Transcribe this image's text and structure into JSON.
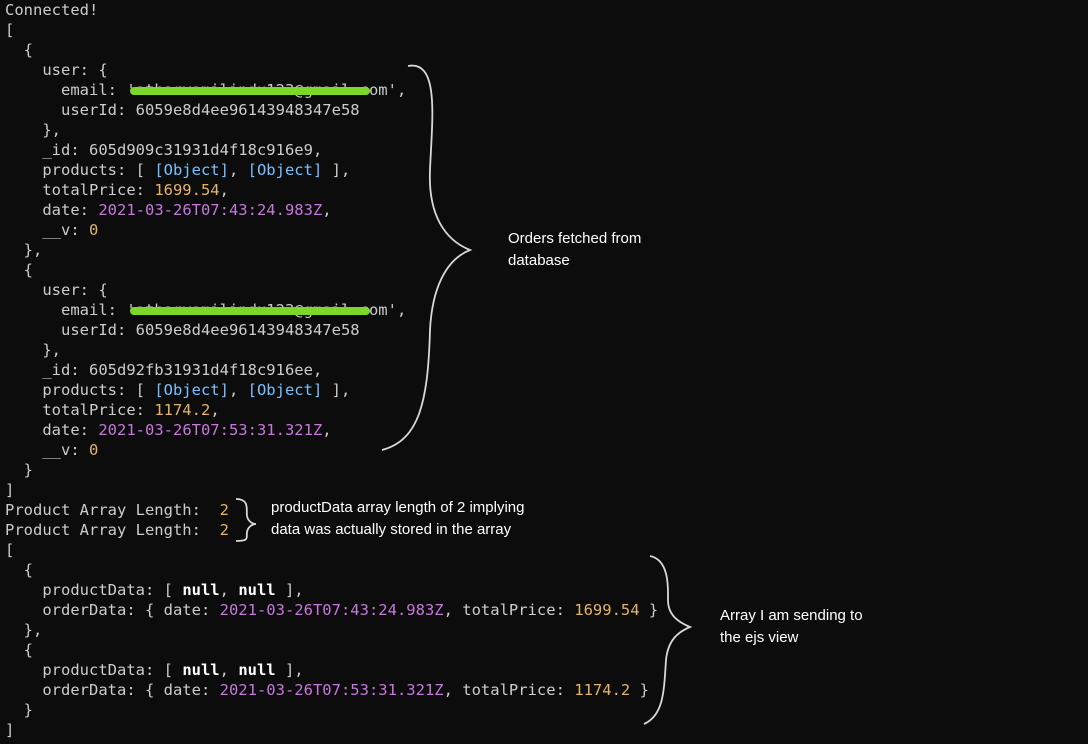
{
  "terminal": {
    "lines": [
      [
        {
          "t": "Connected!",
          "c": ""
        }
      ],
      [
        {
          "t": "[",
          "c": ""
        }
      ],
      [
        {
          "t": "  {",
          "c": ""
        }
      ],
      [
        {
          "t": "    user: {",
          "c": ""
        }
      ],
      [
        {
          "t": "      email: '",
          "c": ""
        },
        {
          "t": "atharvamilindu123@gmail.com",
          "c": "t-email"
        },
        {
          "t": "',",
          "c": ""
        }
      ],
      [
        {
          "t": "      userId: 6059e8d4ee96143948347e58",
          "c": ""
        }
      ],
      [
        {
          "t": "    },",
          "c": ""
        }
      ],
      [
        {
          "t": "    _id: 605d909c31931d4f18c916e9,",
          "c": ""
        }
      ],
      [
        {
          "t": "    products: [ ",
          "c": ""
        },
        {
          "t": "[Object]",
          "c": "t-cyan"
        },
        {
          "t": ", ",
          "c": ""
        },
        {
          "t": "[Object]",
          "c": "t-cyan"
        },
        {
          "t": " ],",
          "c": ""
        }
      ],
      [
        {
          "t": "    totalPrice: ",
          "c": ""
        },
        {
          "t": "1699.54",
          "c": "t-num"
        },
        {
          "t": ",",
          "c": ""
        }
      ],
      [
        {
          "t": "    date: ",
          "c": ""
        },
        {
          "t": "2021-03-26T07:43:24.983Z",
          "c": "t-date"
        },
        {
          "t": ",",
          "c": ""
        }
      ],
      [
        {
          "t": "    __v: ",
          "c": ""
        },
        {
          "t": "0",
          "c": "t-num"
        }
      ],
      [
        {
          "t": "  },",
          "c": ""
        }
      ],
      [
        {
          "t": "  {",
          "c": ""
        }
      ],
      [
        {
          "t": "    user: {",
          "c": ""
        }
      ],
      [
        {
          "t": "      email: '",
          "c": ""
        },
        {
          "t": "atharvamilindu123@gmail.com",
          "c": "t-email"
        },
        {
          "t": "',",
          "c": ""
        }
      ],
      [
        {
          "t": "      userId: 6059e8d4ee96143948347e58",
          "c": ""
        }
      ],
      [
        {
          "t": "    },",
          "c": ""
        }
      ],
      [
        {
          "t": "    _id: 605d92fb31931d4f18c916ee,",
          "c": ""
        }
      ],
      [
        {
          "t": "    products: [ ",
          "c": ""
        },
        {
          "t": "[Object]",
          "c": "t-cyan"
        },
        {
          "t": ", ",
          "c": ""
        },
        {
          "t": "[Object]",
          "c": "t-cyan"
        },
        {
          "t": " ],",
          "c": ""
        }
      ],
      [
        {
          "t": "    totalPrice: ",
          "c": ""
        },
        {
          "t": "1174.2",
          "c": "t-num"
        },
        {
          "t": ",",
          "c": ""
        }
      ],
      [
        {
          "t": "    date: ",
          "c": ""
        },
        {
          "t": "2021-03-26T07:53:31.321Z",
          "c": "t-date"
        },
        {
          "t": ",",
          "c": ""
        }
      ],
      [
        {
          "t": "    __v: ",
          "c": ""
        },
        {
          "t": "0",
          "c": "t-num"
        }
      ],
      [
        {
          "t": "  }",
          "c": ""
        }
      ],
      [
        {
          "t": "]",
          "c": ""
        }
      ],
      [
        {
          "t": "Product Array Length:  ",
          "c": ""
        },
        {
          "t": "2",
          "c": "t-num"
        }
      ],
      [
        {
          "t": "Product Array Length:  ",
          "c": ""
        },
        {
          "t": "2",
          "c": "t-num"
        }
      ],
      [
        {
          "t": "[",
          "c": ""
        }
      ],
      [
        {
          "t": "  {",
          "c": ""
        }
      ],
      [
        {
          "t": "    productData: [ ",
          "c": ""
        },
        {
          "t": "null",
          "c": "t-bold"
        },
        {
          "t": ", ",
          "c": ""
        },
        {
          "t": "null",
          "c": "t-bold"
        },
        {
          "t": " ],",
          "c": ""
        }
      ],
      [
        {
          "t": "    orderData: { date: ",
          "c": ""
        },
        {
          "t": "2021-03-26T07:43:24.983Z",
          "c": "t-date"
        },
        {
          "t": ", totalPrice: ",
          "c": ""
        },
        {
          "t": "1699.54",
          "c": "t-num"
        },
        {
          "t": " }",
          "c": ""
        }
      ],
      [
        {
          "t": "  },",
          "c": ""
        }
      ],
      [
        {
          "t": "  {",
          "c": ""
        }
      ],
      [
        {
          "t": "    productData: [ ",
          "c": ""
        },
        {
          "t": "null",
          "c": "t-bold"
        },
        {
          "t": ", ",
          "c": ""
        },
        {
          "t": "null",
          "c": "t-bold"
        },
        {
          "t": " ],",
          "c": ""
        }
      ],
      [
        {
          "t": "    orderData: { date: ",
          "c": ""
        },
        {
          "t": "2021-03-26T07:53:31.321Z",
          "c": "t-date"
        },
        {
          "t": ", totalPrice: ",
          "c": ""
        },
        {
          "t": "1174.2",
          "c": "t-num"
        },
        {
          "t": " }",
          "c": ""
        }
      ],
      [
        {
          "t": "  }",
          "c": ""
        }
      ],
      [
        {
          "t": "]",
          "c": ""
        }
      ]
    ]
  },
  "annotations": {
    "orders_note": [
      "Orders fetched from",
      "database"
    ],
    "length_note": [
      "productData array length of 2 implying",
      "data was actually stored in the array"
    ],
    "array_note": [
      "Array I am sending to",
      "the ejs view"
    ]
  },
  "colors": {
    "background": "#0c0c0c",
    "text": "#cccccc",
    "object": "#79c0ff",
    "number": "#e5b567",
    "date": "#c678dd",
    "redaction": "#7bd82a"
  }
}
